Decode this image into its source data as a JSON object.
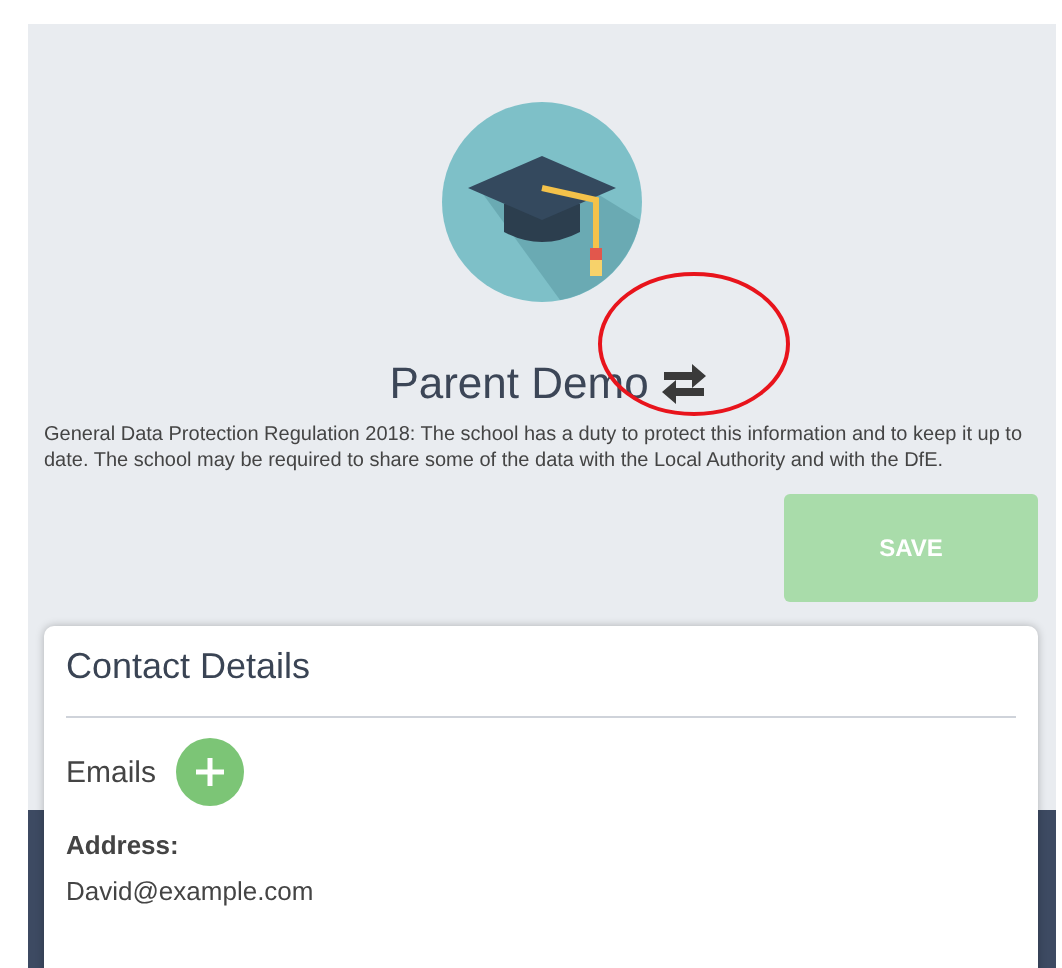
{
  "profile": {
    "name": "Parent Demo"
  },
  "notice": "General Data Protection Regulation 2018: The school has a duty to protect this information and to keep it up to date. The school may be required to share some of the data with the Local Authority and with the DfE.",
  "save_button": {
    "label": "SAVE",
    "disabled": true
  },
  "contact": {
    "title": "Contact Details",
    "emails_label": "Emails",
    "address_label": "Address:",
    "address_value": "David@example.com"
  }
}
